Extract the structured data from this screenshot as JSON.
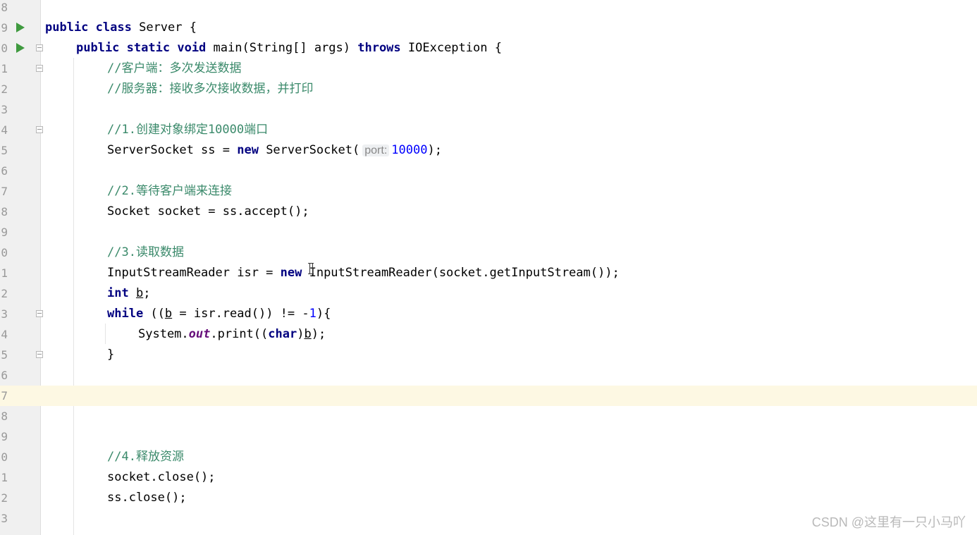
{
  "lines": [
    {
      "n": "8"
    },
    {
      "n": "9",
      "run": true,
      "t": [
        {
          "c": "kw",
          "v": "public"
        },
        {
          "v": " "
        },
        {
          "c": "kw",
          "v": "class"
        },
        {
          "v": " Server {"
        }
      ]
    },
    {
      "n": "0",
      "run": true,
      "fold": true,
      "t": [
        {
          "c": "kw",
          "v": "public"
        },
        {
          "v": " "
        },
        {
          "c": "kw",
          "v": "static"
        },
        {
          "v": " "
        },
        {
          "c": "kw",
          "v": "void"
        },
        {
          "v": " main(String[] args) "
        },
        {
          "c": "kw",
          "v": "throws"
        },
        {
          "v": " IOException {"
        }
      ]
    },
    {
      "n": "1",
      "fold": true,
      "t": [
        {
          "c": "cm",
          "v": "//客户端：多次发送数据"
        }
      ]
    },
    {
      "n": "2",
      "t": [
        {
          "c": "cm",
          "v": "//服务器：接收多次接收数据，并打印"
        }
      ]
    },
    {
      "n": "3"
    },
    {
      "n": "4",
      "fold": true,
      "t": [
        {
          "c": "cm",
          "v": "//1.创建对象绑定10000端口"
        }
      ]
    },
    {
      "n": "5",
      "t": [
        {
          "v": "ServerSocket ss = "
        },
        {
          "c": "kw",
          "v": "new"
        },
        {
          "v": " ServerSocket("
        },
        {
          "c": "hint",
          "v": "port:"
        },
        {
          "c": "num",
          "v": "10000"
        },
        {
          "v": ");"
        }
      ]
    },
    {
      "n": "6"
    },
    {
      "n": "7",
      "t": [
        {
          "c": "cm",
          "v": "//2.等待客户端来连接"
        }
      ]
    },
    {
      "n": "8",
      "t": [
        {
          "v": "Socket socket = ss.accept();"
        }
      ]
    },
    {
      "n": "9"
    },
    {
      "n": "0",
      "t": [
        {
          "c": "cm",
          "v": "//3.读取数据"
        }
      ]
    },
    {
      "n": "1",
      "t": [
        {
          "v": "InputStreamReader isr = "
        },
        {
          "c": "kw",
          "v": "new"
        },
        {
          "v": " InputStreamReader(socket.getInputStream());"
        }
      ]
    },
    {
      "n": "2",
      "t": [
        {
          "c": "kw",
          "v": "int"
        },
        {
          "v": " "
        },
        {
          "c": "und",
          "v": "b"
        },
        {
          "v": ";"
        }
      ]
    },
    {
      "n": "3",
      "fold": true,
      "t": [
        {
          "c": "kw",
          "v": "while"
        },
        {
          "v": " (("
        },
        {
          "c": "und",
          "v": "b"
        },
        {
          "v": " = isr.read()) != -"
        },
        {
          "c": "num",
          "v": "1"
        },
        {
          "v": "){"
        }
      ]
    },
    {
      "n": "4",
      "t": [
        {
          "v": "System."
        },
        {
          "c": "fld",
          "v": "out"
        },
        {
          "v": ".print(("
        },
        {
          "c": "kw",
          "v": "char"
        },
        {
          "v": ")"
        },
        {
          "c": "und",
          "v": "b"
        },
        {
          "v": ");"
        }
      ]
    },
    {
      "n": "5",
      "fold": true,
      "t": [
        {
          "v": "}"
        }
      ]
    },
    {
      "n": "6"
    },
    {
      "n": "7",
      "current": true
    },
    {
      "n": "8"
    },
    {
      "n": "9"
    },
    {
      "n": "0",
      "t": [
        {
          "c": "cm",
          "v": "//4.释放资源"
        }
      ]
    },
    {
      "n": "1",
      "t": [
        {
          "v": "socket.close();"
        }
      ]
    },
    {
      "n": "2",
      "t": [
        {
          "v": "ss.close();"
        }
      ]
    },
    {
      "n": "3"
    }
  ],
  "watermark": "CSDN @这里有一只小马吖",
  "colors": {
    "keyword": "#000080",
    "comment": "#3b8a6b",
    "number": "#0000ff",
    "field": "#660e7a",
    "current_line": "#fdf8e3",
    "run_icon": "#3f9a3f"
  }
}
